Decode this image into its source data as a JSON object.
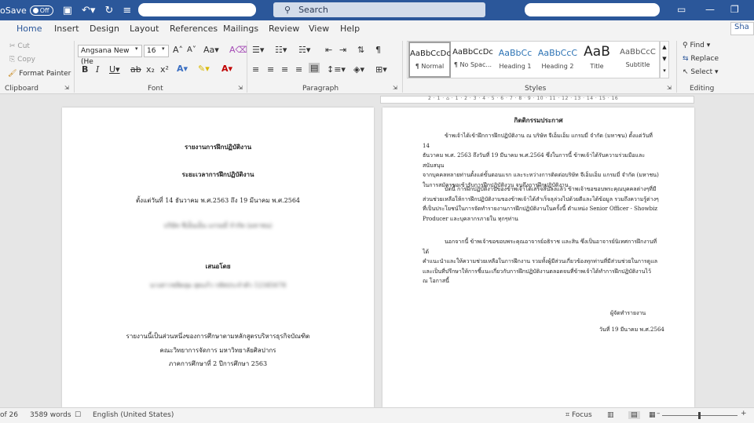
{
  "titlebar": {
    "autosave_label": "oSave",
    "autosave_state": "Off",
    "search_label": "Search"
  },
  "tabs": [
    "Home",
    "Insert",
    "Design",
    "Layout",
    "References",
    "Mailings",
    "Review",
    "View",
    "Help"
  ],
  "share_label": "Sha",
  "ribbon": {
    "clipboard": {
      "cut": "Cut",
      "copy": "Copy",
      "format_painter": "Format Painter",
      "label": "Clipboard"
    },
    "font": {
      "name": "Angsana New (He",
      "size": "16",
      "case_label": "Aa",
      "label": "Font"
    },
    "paragraph": {
      "label": "Paragraph"
    },
    "styles": {
      "label": "Styles",
      "items": [
        {
          "sample": "AaBbCcDc",
          "name": "¶ Normal"
        },
        {
          "sample": "AaBbCcDc",
          "name": "¶ No Spac..."
        },
        {
          "sample": "AaBbCc",
          "name": "Heading 1"
        },
        {
          "sample": "AaBbCcC",
          "name": "Heading 2"
        },
        {
          "sample": "AaB",
          "name": "Title"
        },
        {
          "sample": "AaBbCcC",
          "name": "Subtitle"
        }
      ]
    },
    "editing": {
      "find": "Find",
      "replace": "Replace",
      "select": "Select",
      "label": "Editing"
    }
  },
  "ruler_text": "2 · 1 · ⌂ · 1 · 2 · 3 · 4 · 5 · 6 · 7 · 8 · 9 · 10 · 11 · 12 · 13 · 14 · 15 · 16",
  "left_page": {
    "title": "รายงานการฝึกปฏิบัติงาน",
    "subtitle": "ระยะเวลาการฝึกปฏิบัติงาน",
    "period": "ตั้งแต่วันที่ 14 ธันวาคม พ.ศ.2563 ถึง 19 มีนาคม พ.ศ.2564",
    "company_blurred": "บริษัท ซีเอ็นเอ็น แกรมมี่ จำกัด (มหาชน)",
    "presented_by": "เสนอโดย",
    "student_blurred": "นางสาวชลิตลุม สุดแก้ว รหัสประจำตัว 12345678",
    "footer1": "รายงานนี้เป็นส่วนหนึ่งของการศึกษาตามหลักสูตรบริหารธุรกิจบัณฑิต",
    "footer2": "คณะวิทยาการจัดการ มหาวิทยาลัยศิลปากร",
    "footer3": "ภาคการศึกษาที่ 2 ปีการศึกษา 2563"
  },
  "right_page": {
    "heading": "กิตติกรรมประกาศ",
    "p1": [
      "ข้าพเจ้าได้เข้าฝึกการฝึกปฏิบัติงาน ณ บริษัท จีเอ็มเอ็ม แกรมมี่ จำกัด (มหาชน) ตั้งแต่วันที่ 14",
      "ธันวาคม พ.ศ. 2563 ถึงวันที่ 19 มีนาคม พ.ศ.2564 ซึ่งในการนี้ ข้าพเจ้าได้รับความร่วมมือและสนับสนุน",
      "จากบุคคลหลายท่านตั้งแต่ขั้นตอนแรก และระหว่างการติดต่อบริษัท จีเอ็มเอ็ม แกรมมี่ จำกัด (มหาชน)",
      "ในการสมัครขอเข้ารับการฝึกปฏิบัติงาน จนถึงการฝึกปฏิบัติงาน"
    ],
    "p2": [
      "บัดนี้ การฝึกปฏิบัติงานของข้าพเจ้าได้เสร็จสิ้นลงแล้ว ข้าพเจ้าขอขอบพระคุณบุคคลต่างๆที่มี",
      "ส่วนช่วยเหลือให้การฝึกปฏิบัติงานของข้าพเจ้าได้สำเร็จลุล่วงไปด้วยดีและได้ข้อมูล รวมถึงความรู้ต่างๆ",
      "ที่เป็นประโยชน์ในการจัดทำรายงานการฝึกปฏิบัติงานในครั้งนี้ ตำแหน่ง Senior Officer - Showbiz",
      "Producer และบุคลากรภายใน ทุกๆท่าน"
    ],
    "p3": [
      "นอกจากนี้ ข้าพเจ้าขอขอบพระคุณอาจารย์อธิราช และสิน ซึ่งเป็นอาจารย์นิเทศการฝึกงานที่ได้",
      "คำแนะนำและให้ความช่วยเหลือในการฝึกงาน รวมทั้งผู้มีส่วนเกี่ยวข้องทุกท่านที่มีส่วนช่วยในการดูแล",
      "และเป็นที่ปรึกษาให้การชี้แนะเกี่ยวกับการฝึกปฏิบัติงานตลอดจนที่ข้าพเจ้าได้ทำการฝึกปฏิบัติงานไว้",
      "ณ โอกาสนี้"
    ],
    "signer": "ผู้จัดทำรายงาน",
    "date": "วันที่ 19 มีนาคม พ.ศ.2564"
  },
  "status": {
    "page": "of 26",
    "words": "3589 words",
    "language": "English (United States)",
    "focus": "Focus"
  }
}
